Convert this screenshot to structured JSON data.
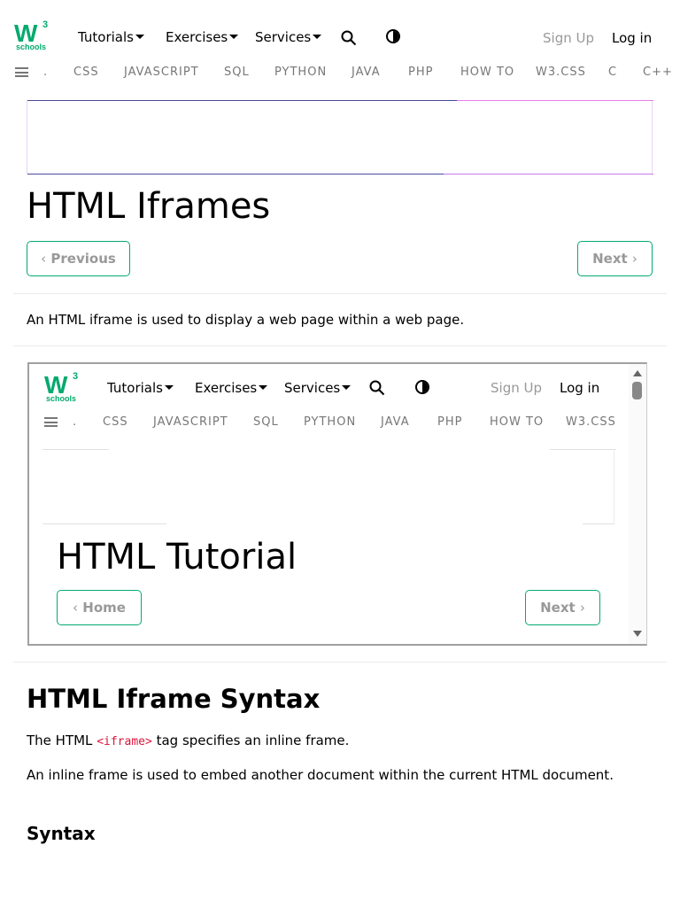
{
  "header": {
    "logo_mark": "W",
    "logo_sup": "3",
    "logo_sub": "schools",
    "nav": [
      {
        "label": "Tutorials"
      },
      {
        "label": "Exercises"
      },
      {
        "label": "Services"
      }
    ],
    "signup": "Sign Up",
    "login": "Log in"
  },
  "subnav": {
    "items": [
      ".",
      "CSS",
      "JAVASCRIPT",
      "SQL",
      "PYTHON",
      "JAVA",
      "PHP",
      "HOW TO",
      "W3.CSS",
      "C",
      "C++"
    ]
  },
  "page": {
    "title": "HTML Iframes",
    "prev_label": "Previous",
    "next_label": "Next",
    "intro": "An HTML iframe is used to display a web page within a web page.",
    "section_title": "HTML Iframe Syntax",
    "syntax_line_pre": "The HTML ",
    "syntax_tag": "<iframe>",
    "syntax_line_post": " tag specifies an inline frame.",
    "inline_frame_desc": "An inline frame is used to embed another document within the current HTML document.",
    "syntax_heading": "Syntax"
  },
  "iframe": {
    "nav": [
      {
        "label": "Tutorials"
      },
      {
        "label": "Exercises"
      },
      {
        "label": "Services"
      }
    ],
    "signup": "Sign Up",
    "login": "Log in",
    "subnav_items": [
      ".",
      "CSS",
      "JAVASCRIPT",
      "SQL",
      "PYTHON",
      "JAVA",
      "PHP",
      "HOW TO",
      "W3.CSS"
    ],
    "title": "HTML Tutorial",
    "home_label": "Home",
    "next_label": "Next"
  },
  "colors": {
    "brand_green": "#04aa6d",
    "muted_text": "#999999",
    "code_red": "#dc143c"
  }
}
